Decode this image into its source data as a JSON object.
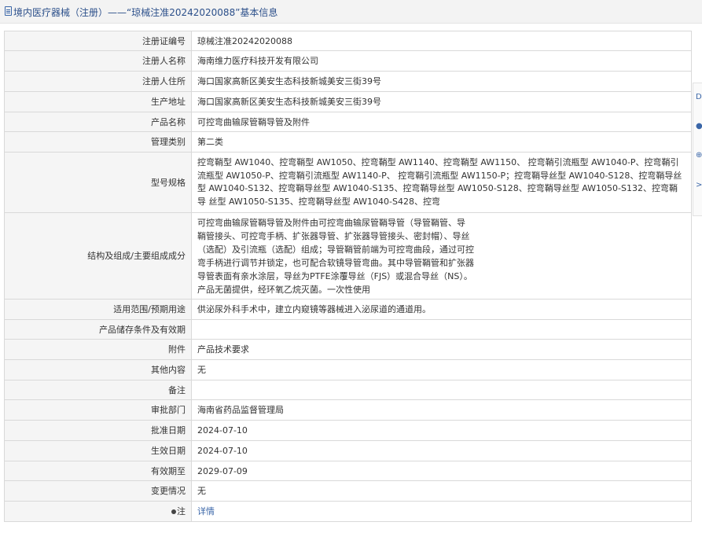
{
  "header": {
    "title": "境内医疗器械（注册）——“琼械注准20242020088”基本信息"
  },
  "rows": [
    {
      "label": "注册证编号",
      "value": "琼械注准20242020088"
    },
    {
      "label": "注册人名称",
      "value": "海南维力医疗科技开发有限公司"
    },
    {
      "label": "注册人住所",
      "value": "海口国家高新区美安生态科技新城美安三街39号"
    },
    {
      "label": "生产地址",
      "value": "海口国家高新区美安生态科技新城美安三街39号"
    },
    {
      "label": "产品名称",
      "value": "可控弯曲输尿管鞘导管及附件"
    },
    {
      "label": "管理类别",
      "value": "第二类"
    },
    {
      "label": "型号规格",
      "value": "控弯鞘型 AW1040、控弯鞘型 AW1050、控弯鞘型 AW1140、控弯鞘型 AW1150、 控弯鞘引流瓶型 AW1040-P、控弯鞘引流瓶型 AW1050-P、控弯鞘引流瓶型 AW1140-P、 控弯鞘引流瓶型 AW1150-P；控弯鞘导丝型 AW1040-S128、控弯鞘导丝型 AW1040-S132、控弯鞘导丝型 AW1040-S135、控弯鞘导丝型 AW1050-S128、控弯鞘导丝型 AW1050-S132、控弯鞘导 丝型 AW1050-S135、控弯鞘导丝型 AW1040-S428、控弯"
    },
    {
      "label": "结构及组成/主要组成成分",
      "value": "可控弯曲输尿管鞘导管及附件由可控弯曲输尿管鞘导管（导管鞘管、导\n鞘管接头、可控弯手柄、扩张器导管、扩张器导管接头、密封帽）、导丝\n（选配）及引流瓶（选配）组成；导管鞘管前端为可控弯曲段，通过可控\n弯手柄进行调节并锁定，也可配合软镜导管弯曲。其中导管鞘管和扩张器\n导管表面有亲水涂层，导丝为PTFE涂覆导丝（FJS）或混合导丝（NS）。\n产品无菌提供，经环氧乙烷灭菌。一次性使用"
    },
    {
      "label": "适用范围/预期用途",
      "value": "供泌尿外科手术中，建立内窥镜等器械进入泌尿道的通道用。"
    },
    {
      "label": "产品储存条件及有效期",
      "value": ""
    },
    {
      "label": "附件",
      "value": "产品技术要求"
    },
    {
      "label": "其他内容",
      "value": "无"
    },
    {
      "label": "备注",
      "value": ""
    },
    {
      "label": "审批部门",
      "value": "海南省药品监督管理局"
    },
    {
      "label": "批准日期",
      "value": "2024-07-10"
    },
    {
      "label": "生效日期",
      "value": "2024-07-10"
    },
    {
      "label": "有效期至",
      "value": "2029-07-09"
    },
    {
      "label": "变更情况",
      "value": "无"
    }
  ],
  "note": {
    "label": "注",
    "link": "详情"
  },
  "sidebar": {
    "items": [
      "D",
      "●",
      "⊕",
      ">"
    ]
  }
}
